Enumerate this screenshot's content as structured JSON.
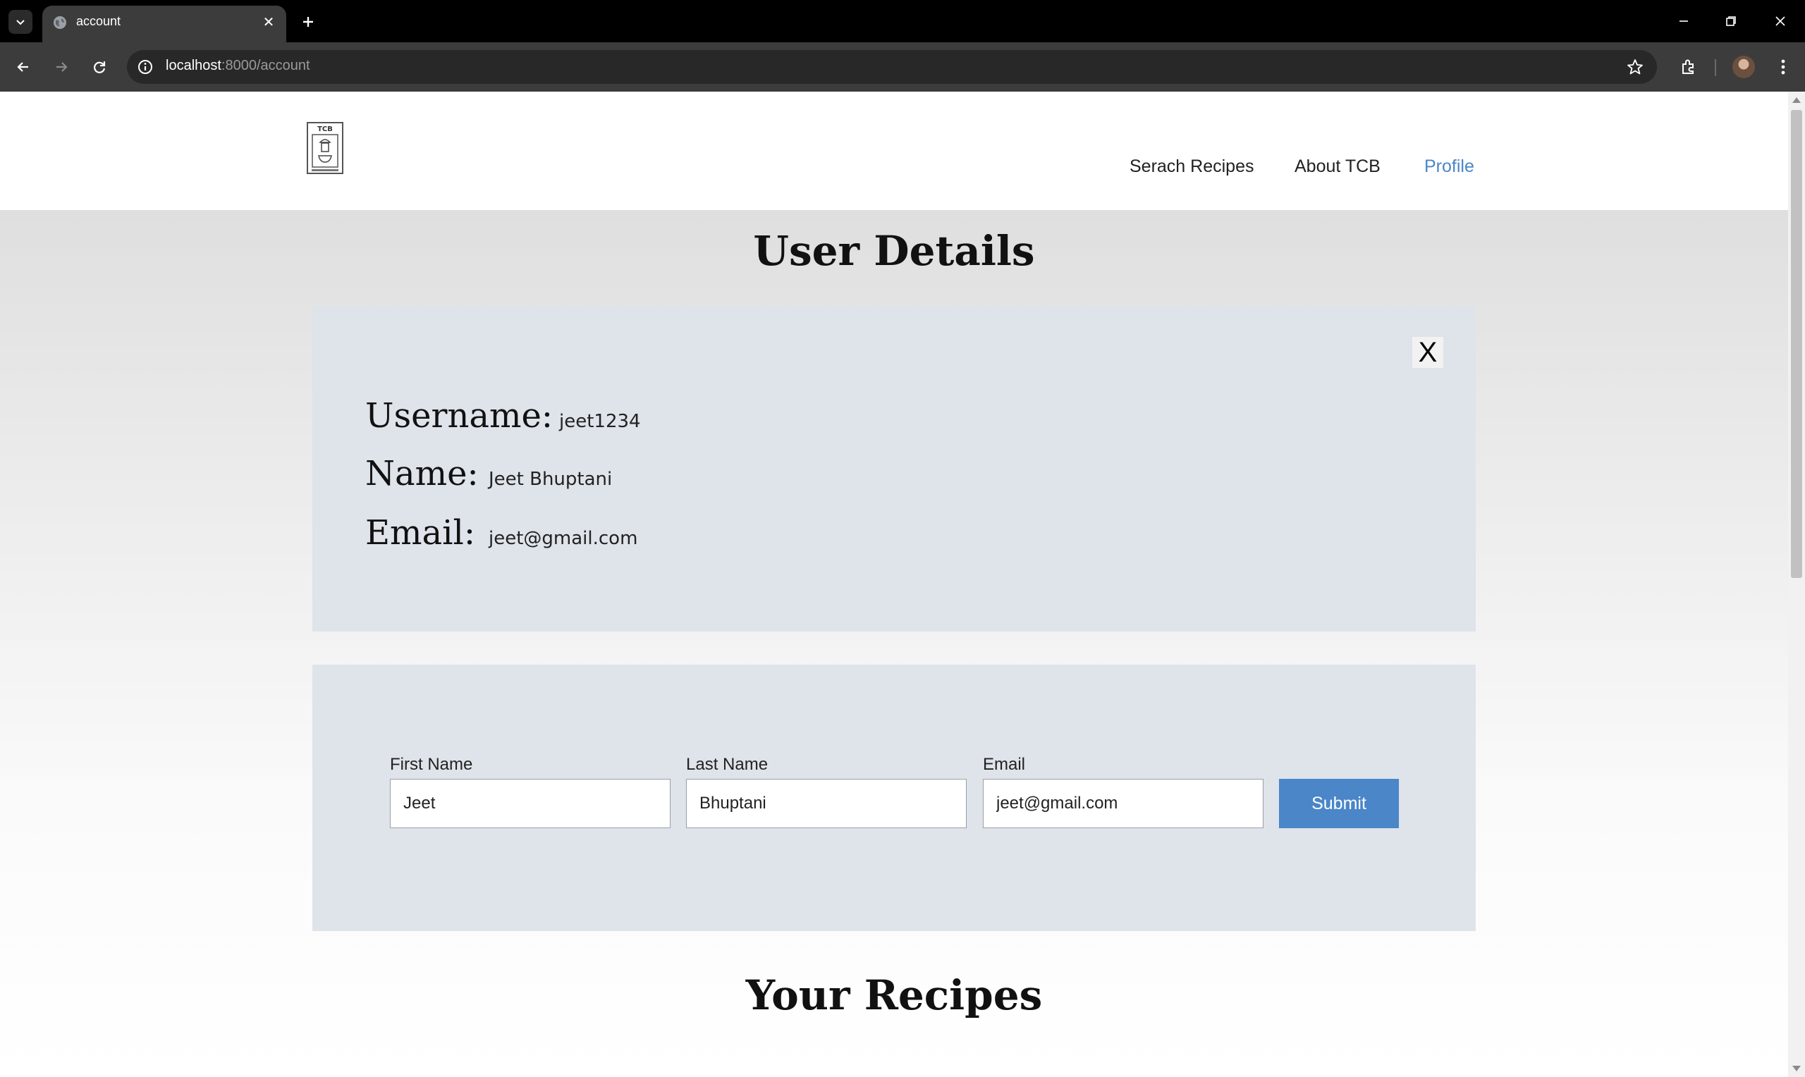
{
  "browser": {
    "tab_title": "account",
    "url_host": "localhost",
    "url_rest": ":8000/account"
  },
  "nav": {
    "links": [
      "Serach Recipes",
      "About TCB",
      "Profile"
    ],
    "active_color": "#4a86c8"
  },
  "logo": {
    "text": "TCB"
  },
  "user_details": {
    "heading": "User Details",
    "close_label": "X",
    "username_label": "Username:",
    "username_value": "jeet1234",
    "name_label": "Name:",
    "name_value": "Jeet Bhuptani",
    "email_label": "Email:",
    "email_value": "jeet@gmail.com"
  },
  "form": {
    "first_name_label": "First Name",
    "first_name_value": "Jeet",
    "last_name_label": "Last Name",
    "last_name_value": "Bhuptani",
    "email_label": "Email",
    "email_value": "jeet@gmail.com",
    "submit_label": "Submit"
  },
  "recipes": {
    "heading": "Your Recipes"
  },
  "colors": {
    "panel": "#dfe3ea",
    "accent": "#4a86c8"
  }
}
